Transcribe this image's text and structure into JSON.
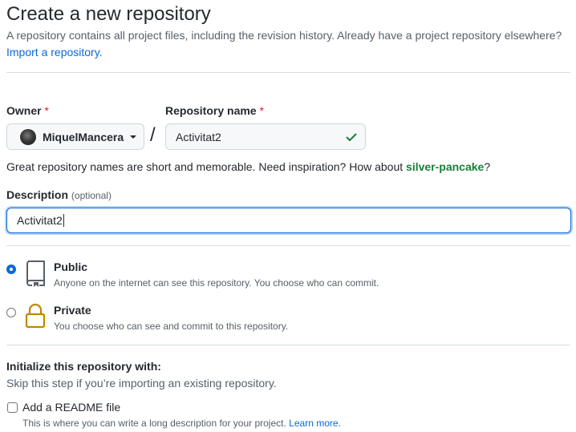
{
  "header": {
    "title": "Create a new repository",
    "subtitle": "A repository contains all project files, including the revision history. Already have a project repository elsewhere?",
    "import_link": "Import a repository."
  },
  "owner": {
    "label": "Owner",
    "required_mark": "*",
    "value": "MiquelMancera"
  },
  "repo_name": {
    "label": "Repository name",
    "required_mark": "*",
    "value": "Activitat2"
  },
  "separator": "/",
  "name_hint": {
    "text": "Great repository names are short and memorable. Need inspiration? How about",
    "suggestion": "silver-pancake",
    "suffix": "?"
  },
  "description": {
    "label": "Description",
    "optional": "(optional)",
    "value": "Activitat2"
  },
  "visibility": {
    "public": {
      "title": "Public",
      "desc": "Anyone on the internet can see this repository. You choose who can commit.",
      "checked": true
    },
    "private": {
      "title": "Private",
      "desc": "You choose who can see and commit to this repository.",
      "checked": false
    }
  },
  "initialize": {
    "title": "Initialize this repository with:",
    "subtitle": "Skip this step if you’re importing an existing repository.",
    "readme_label": "Add a README file",
    "readme_desc": "This is where you can write a long description for your project.",
    "learn_more": "Learn more."
  },
  "colors": {
    "accent": "#0969da",
    "success": "#1a7f37",
    "danger": "#cf222e",
    "lock": "#bf8700"
  },
  "icons": {
    "check": "check-icon",
    "public": "repo-icon",
    "private": "lock-icon",
    "dropdown": "triangle-down-icon"
  }
}
